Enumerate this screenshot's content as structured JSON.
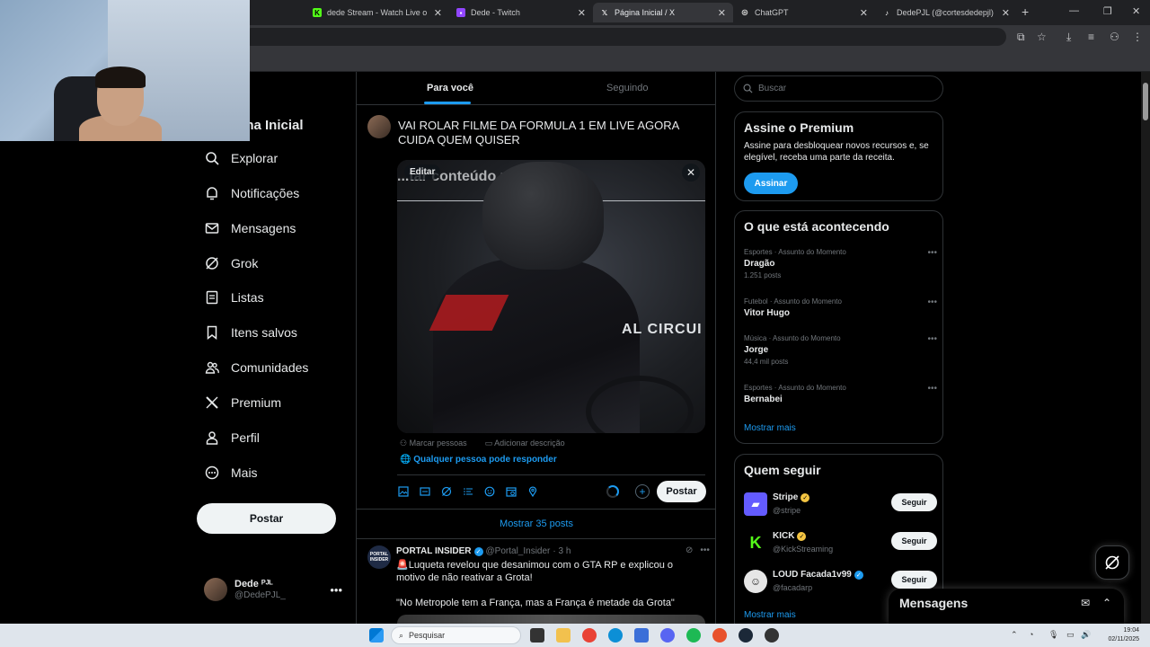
{
  "browser": {
    "tabs": [
      {
        "title": "dede Stream - Watch Live on K",
        "favicon": "kick-icon",
        "color": "#53fc18",
        "active": false
      },
      {
        "title": "Dede - Twitch",
        "favicon": "twitch-icon",
        "color": "#9146ff",
        "active": false
      },
      {
        "title": "Página Inicial / X",
        "favicon": "x-icon",
        "color": "#ffffff",
        "active": true
      },
      {
        "title": "ChatGPT",
        "favicon": "chatgpt-icon",
        "color": "#cccccc",
        "active": false
      },
      {
        "title": "DedePJL (@cortesdedepjl) | Tik",
        "favicon": "tiktok-icon",
        "color": "#ffffff",
        "active": false
      }
    ],
    "new_tab": "+"
  },
  "nav": {
    "title": "gina Inicial",
    "items": [
      {
        "label": "Explorar",
        "icon": "search-icon"
      },
      {
        "label": "Notificações",
        "icon": "bell-icon"
      },
      {
        "label": "Mensagens",
        "icon": "mail-icon"
      },
      {
        "label": "Grok",
        "icon": "grok-icon"
      },
      {
        "label": "Listas",
        "icon": "list-icon"
      },
      {
        "label": "Itens salvos",
        "icon": "bookmark-icon"
      },
      {
        "label": "Comunidades",
        "icon": "people-icon"
      },
      {
        "label": "Premium",
        "icon": "x-logo-icon"
      },
      {
        "label": "Perfil",
        "icon": "person-icon"
      },
      {
        "label": "Mais",
        "icon": "more-circle-icon"
      }
    ],
    "post_button": "Postar",
    "account": {
      "name": "Dede ᴾᴶᴸ",
      "handle": "@DedePJL_"
    }
  },
  "timeline": {
    "tabs": {
      "for_you": "Para você",
      "following": "Seguindo"
    },
    "compose": {
      "text": "VAI ROLAR FILME DA FORMULA 1 EM LIVE AGORA CUIDA QUEM QUISER",
      "media_headline": "...tar conteúdo relacionado",
      "media_sign": "AL CIRCUI",
      "edit_label": "Editar",
      "close": "✕",
      "tag_people": "Marcar pessoas",
      "add_description": "Adicionar descrição",
      "reply_setting": "Qualquer pessoa pode responder",
      "post_label": "Postar"
    },
    "show_more_posts": "Mostrar 35 posts",
    "tweet": {
      "avatar_text": "PORTAL INSIDER",
      "name": "PORTAL INSIDER",
      "handle": "@Portal_Insider",
      "time": "· 3 h",
      "body": "🚨Luqueta revelou que desanimou com o GTA RP e explicou o motivo de não reativar a Grota!\n\n\"No Metropole tem a França, mas a França é metade da Grota\""
    }
  },
  "right": {
    "search_placeholder": "Buscar",
    "premium": {
      "title": "Assine o Premium",
      "text": "Assine para desbloquear novos recursos e, se elegível, receba uma parte da receita.",
      "button": "Assinar"
    },
    "trends": {
      "title": "O que está acontecendo",
      "items": [
        {
          "category": "Esportes · Assunto do Momento",
          "name": "Dragão",
          "count": "1.251 posts"
        },
        {
          "category": "Futebol · Assunto do Momento",
          "name": "Vitor Hugo",
          "count": ""
        },
        {
          "category": "Música · Assunto do Momento",
          "name": "Jorge",
          "count": "44,4 mil posts"
        },
        {
          "category": "Esportes · Assunto do Momento",
          "name": "Bernabei",
          "count": ""
        }
      ],
      "show_more": "Mostrar mais"
    },
    "who_to_follow": {
      "title": "Quem seguir",
      "items": [
        {
          "name": "Stripe",
          "handle": "@stripe",
          "badge_color": "#f4c542",
          "avatar_color": "#635bff",
          "avatar_text": "▰"
        },
        {
          "name": "KICK",
          "handle": "@KickStreaming",
          "badge_color": "#f4c542",
          "avatar_color": "#000000",
          "avatar_text": "K"
        },
        {
          "name": "LOUD Facada1v99",
          "handle": "@facadarp",
          "badge_color": "#1d9bf0",
          "avatar_color": "#e6e6e6",
          "avatar_text": "☺"
        }
      ],
      "follow_label": "Seguir",
      "show_more": "Mostrar mais"
    },
    "messages_label": "Mensagens"
  },
  "taskbar": {
    "search_placeholder": "Pesquisar",
    "time": "19:04",
    "date": "02/11/2025"
  },
  "colors": {
    "accent": "#1d9bf0",
    "background": "#000000",
    "border": "#2f3336",
    "muted": "#71767b"
  }
}
